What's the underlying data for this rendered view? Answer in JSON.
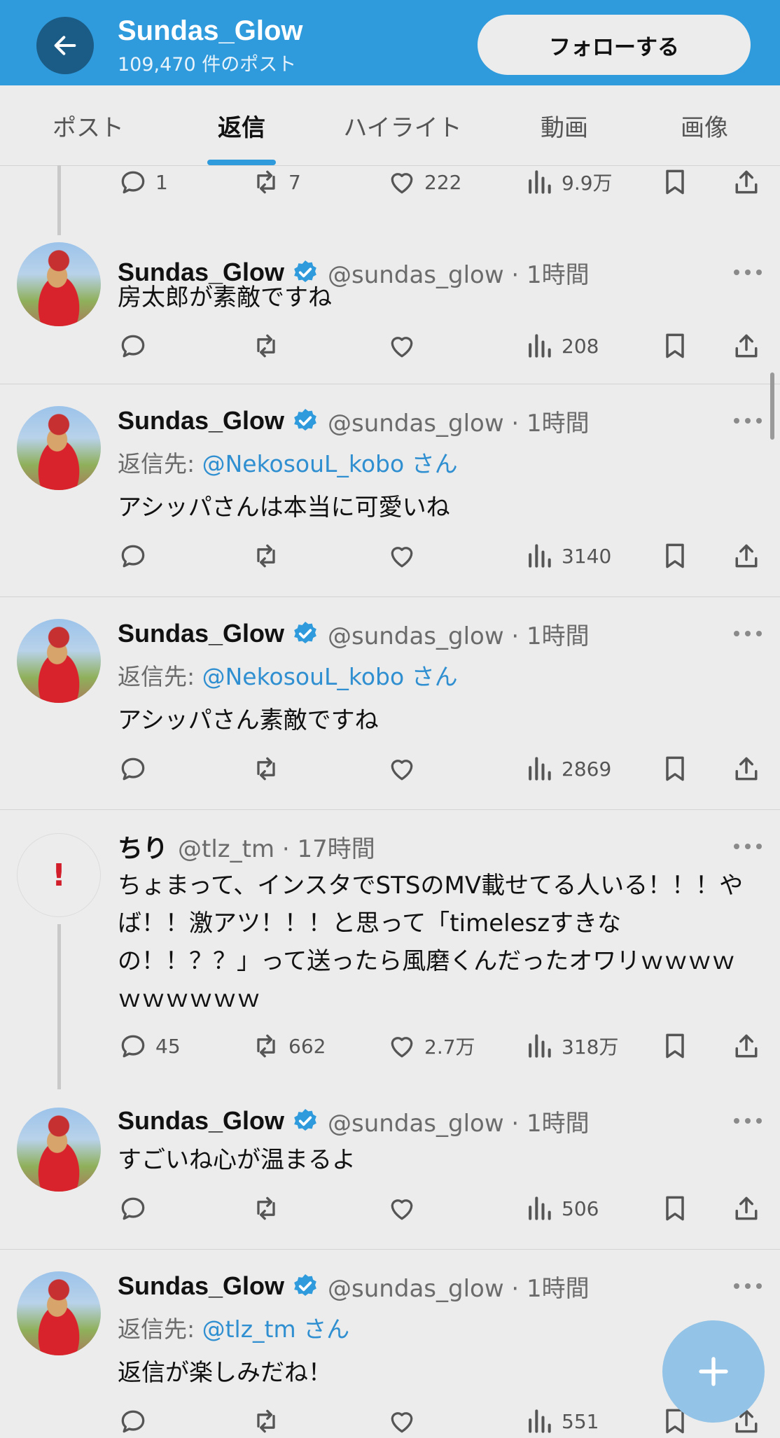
{
  "header": {
    "name": "Sundas_Glow",
    "post_count": "109,470 件のポスト",
    "follow_label": "フォローする"
  },
  "tabs": [
    "ポスト",
    "返信",
    "ハイライト",
    "動画",
    "画像"
  ],
  "active_tab": "返信",
  "top_actions": {
    "reply": "1",
    "repost": "7",
    "like": "222",
    "views": "9.9万"
  },
  "posts": [
    {
      "name": "Sundas_Glow",
      "handle": "@sundas_glow · 1時間",
      "reply_prefix": "",
      "reply_to": "",
      "reply_suffix": "",
      "text": "房太郎が素敵ですね",
      "reply": "",
      "repost": "",
      "like": "",
      "views": "208"
    },
    {
      "name": "Sundas_Glow",
      "handle": "@sundas_glow · 1時間",
      "reply_prefix": "返信先: ",
      "reply_to": "@NekosouL_kobo",
      "reply_suffix": " さん",
      "text": "アシッパさんは本当に可愛いね",
      "reply": "",
      "repost": "",
      "like": "",
      "views": "3140"
    },
    {
      "name": "Sundas_Glow",
      "handle": "@sundas_glow · 1時間",
      "reply_prefix": "返信先: ",
      "reply_to": "@NekosouL_kobo",
      "reply_suffix": " さん",
      "text": "アシッパさん素敵ですね",
      "reply": "",
      "repost": "",
      "like": "",
      "views": "2869"
    },
    {
      "name": "ちり",
      "handle": "@tlz_tm · 17時間",
      "reply_prefix": "",
      "reply_to": "",
      "reply_suffix": "",
      "text": "ちょまって、インスタでSTSのMV載せてる人いる！！！やば！！激アツ！！！と思って「timeleszすきなの！！？？」って送ったら風磨くんだったオワリｗｗｗｗｗｗｗｗｗｗ",
      "reply": "45",
      "repost": "662",
      "like": "2.7万",
      "views": "318万"
    },
    {
      "name": "Sundas_Glow",
      "handle": "@sundas_glow · 1時間",
      "reply_prefix": "",
      "reply_to": "",
      "reply_suffix": "",
      "text": "すごいね心が温まるよ",
      "reply": "",
      "repost": "",
      "like": "",
      "views": "506"
    },
    {
      "name": "Sundas_Glow",
      "handle": "@sundas_glow · 1時間",
      "reply_prefix": "返信先: ",
      "reply_to": "@tlz_tm",
      "reply_suffix": " さん",
      "text": "返信が楽しみだね！",
      "reply": "",
      "repost": "",
      "like": "",
      "views": "551"
    }
  ],
  "icons": {
    "back": "arrow-left-icon",
    "verified": "verified-badge-icon",
    "reply": "comment-bubble-icon",
    "repost": "repost-arrows-icon",
    "like": "heart-icon",
    "views": "bar-chart-icon",
    "bookmark": "bookmark-icon",
    "share": "share-upload-icon",
    "compose": "plus-icon",
    "alert": "exclamation-icon"
  },
  "colors": {
    "accent": "#2f9bdc",
    "mention": "#2f8fd0",
    "fab": "#93c3e6",
    "alert": "#d21e2b"
  }
}
